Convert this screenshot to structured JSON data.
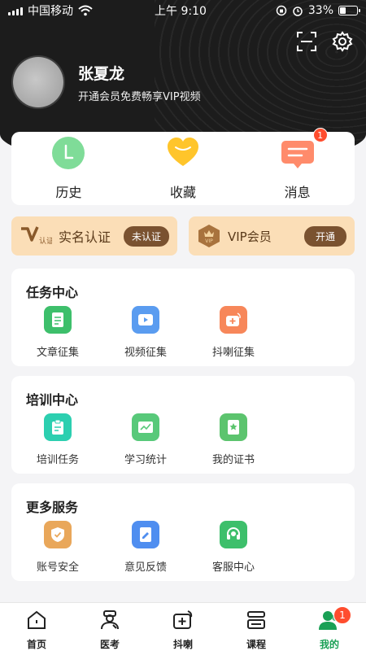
{
  "status_bar": {
    "carrier": "中国移动",
    "time": "上午 9:10",
    "battery": "33%",
    "battery_level": 0.33
  },
  "profile": {
    "name": "张夏龙",
    "vip_tip": "开通会员免费畅享VIP视频"
  },
  "quick": {
    "history": "历史",
    "favorites": "收藏",
    "messages": "消息",
    "messages_badge": "1"
  },
  "cert": {
    "realname_title": "实名认证",
    "realname_status": "未认证",
    "realname_logo_text": "认证",
    "vip_title": "VIP会员",
    "vip_action": "开通",
    "vip_logo_text": "VIP"
  },
  "sections": {
    "task": {
      "title": "任务中心",
      "items": [
        "文章征集",
        "视频征集",
        "抖喇征集"
      ]
    },
    "training": {
      "title": "培训中心",
      "items": [
        "培训任务",
        "学习统计",
        "我的证书"
      ]
    },
    "more": {
      "title": "更多服务",
      "items": [
        "账号安全",
        "意见反馈",
        "客服中心"
      ]
    }
  },
  "tabbar": {
    "items": [
      "首页",
      "医考",
      "抖喇",
      "课程",
      "我的"
    ],
    "active_index": 4,
    "mine_badge": "1"
  },
  "colors": {
    "accent": "#1aa055",
    "header_bg": "#1c1c1c",
    "cert_bg": "#fbdeb7",
    "badge": "#ff4d2e"
  }
}
